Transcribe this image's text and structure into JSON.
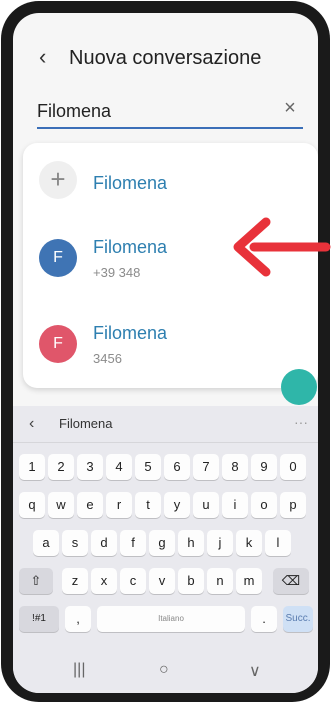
{
  "header": {
    "back_icon": "chevron-left-icon",
    "title": "Nuova conversazione"
  },
  "search": {
    "value": "Filomena",
    "clear_icon": "close-icon"
  },
  "results": [
    {
      "type": "new",
      "icon": "plus-icon",
      "name": "Filomena",
      "number": ""
    },
    {
      "type": "contact",
      "initial": "F",
      "name": "Filomena",
      "number": "+39 348",
      "color": "#3f74b4"
    },
    {
      "type": "contact",
      "initial": "F",
      "name": "Filomena",
      "number": "3456",
      "color": "#e0566a"
    }
  ],
  "annotation": {
    "arrow_color": "#e8323a"
  },
  "keyboard": {
    "suggestion": "Filomena",
    "row_numbers": [
      "1",
      "2",
      "3",
      "4",
      "5",
      "6",
      "7",
      "8",
      "9",
      "0"
    ],
    "row_1": [
      "q",
      "w",
      "e",
      "r",
      "t",
      "y",
      "u",
      "i",
      "o",
      "p"
    ],
    "row_2": [
      "a",
      "s",
      "d",
      "f",
      "g",
      "h",
      "j",
      "k",
      "l"
    ],
    "row_3": [
      "z",
      "x",
      "c",
      "v",
      "b",
      "n",
      "m"
    ],
    "symbols_key": "!#1",
    "comma_key": ",",
    "space_label": "Italiano",
    "period_key": ".",
    "action_key": "Succ."
  },
  "nav": {
    "recents": "|||",
    "home": "○",
    "back": "∨"
  }
}
